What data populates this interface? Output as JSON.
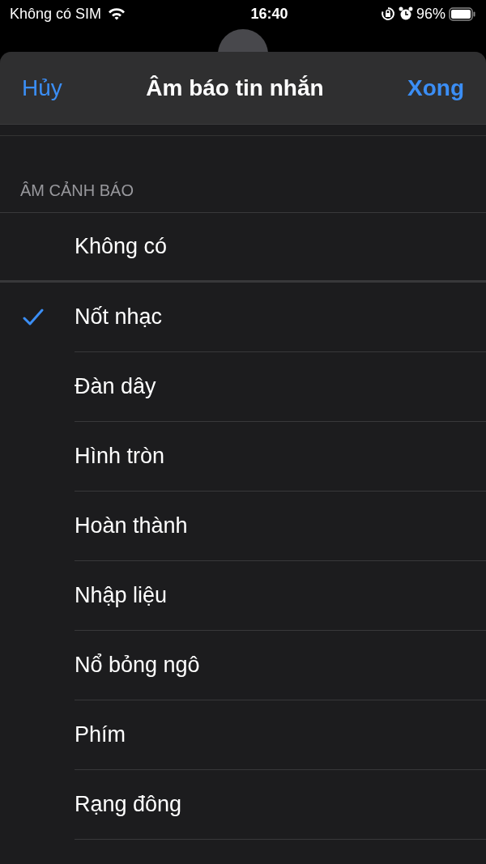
{
  "status_bar": {
    "carrier": "Không có SIM",
    "time": "16:40",
    "battery": "96%"
  },
  "nav": {
    "cancel": "Hủy",
    "title": "Âm báo tin nhắn",
    "done": "Xong"
  },
  "section": {
    "header": "ÂM CẢNH BÁO"
  },
  "none_option": {
    "label": "Không có",
    "selected": false
  },
  "tones": [
    {
      "label": "Nốt nhạc",
      "selected": true
    },
    {
      "label": "Đàn dây",
      "selected": false
    },
    {
      "label": "Hình tròn",
      "selected": false
    },
    {
      "label": "Hoàn thành",
      "selected": false
    },
    {
      "label": "Nhập liệu",
      "selected": false
    },
    {
      "label": "Nổ bỏng ngô",
      "selected": false
    },
    {
      "label": "Phím",
      "selected": false
    },
    {
      "label": "Rạng đông",
      "selected": false
    }
  ]
}
